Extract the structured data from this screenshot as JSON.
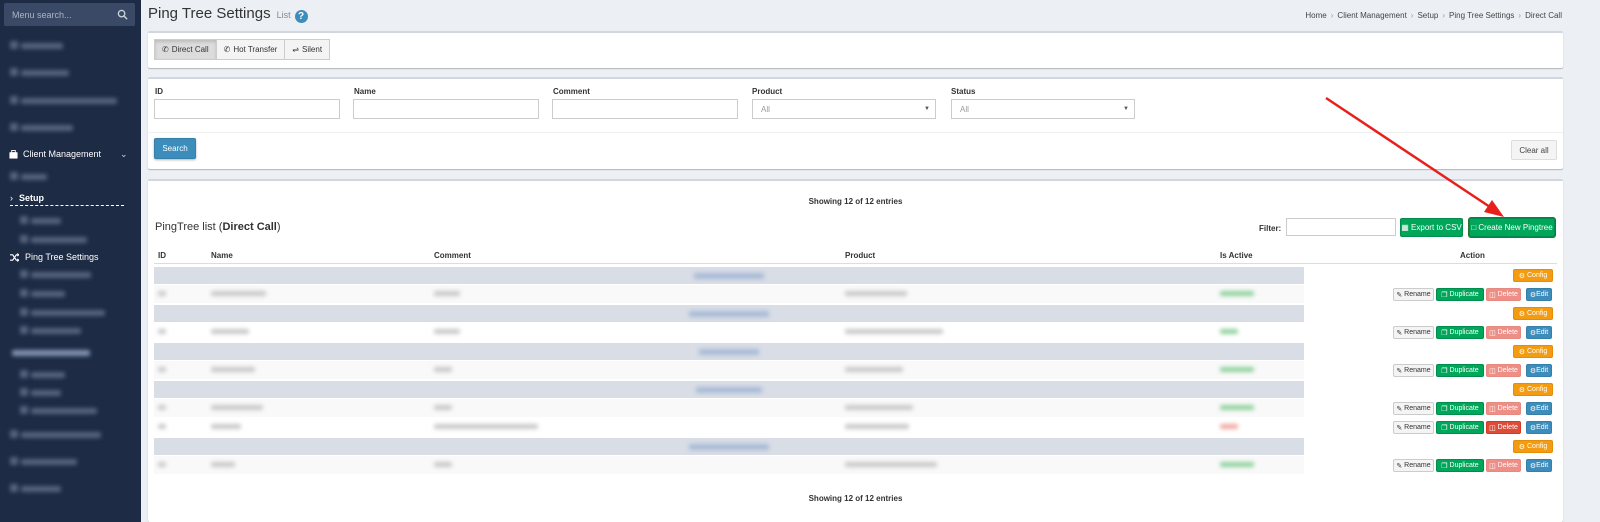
{
  "sidebar": {
    "search_placeholder": "Menu search...",
    "client_management": "Client Management",
    "setup": "Setup",
    "ping_tree_settings": "Ping Tree Settings"
  },
  "header": {
    "title": "Ping Tree Settings",
    "subtitle": "List",
    "help": "?"
  },
  "breadcrumb": [
    "Home",
    "Client Management",
    "Setup",
    "Ping Tree Settings",
    "Direct Call"
  ],
  "tabs": [
    "Direct Call",
    "Hot Transfer",
    "Silent"
  ],
  "filters": {
    "id_label": "ID",
    "name_label": "Name",
    "comment_label": "Comment",
    "product_label": "Product",
    "product_value": "All",
    "status_label": "Status",
    "status_value": "All",
    "search_button": "Search",
    "clear_button": "Clear all"
  },
  "list": {
    "showing_top": "Showing 12 of 12 entries",
    "showing_bottom": "Showing 12 of 12 entries",
    "title_prefix": "PingTree list (",
    "title_bold": "Direct Call",
    "title_suffix": ")",
    "filter_label": "Filter:",
    "export_button": "Export to CSV",
    "create_button": "Create New Pingtree",
    "columns": [
      "ID",
      "Name",
      "Comment",
      "Product",
      "Is Active",
      "Action"
    ],
    "action_labels": {
      "config": "Config",
      "rename": "Rename",
      "duplicate": "Duplicate",
      "delete": "Delete",
      "edit": "Edit"
    }
  },
  "colors": {
    "sidebar_bg": "#1d2b45",
    "primary": "#3c8dbc",
    "success": "#00a65a",
    "warning": "#f39c12",
    "danger": "#dd4b39",
    "annotation_arrow": "#e8201c"
  }
}
